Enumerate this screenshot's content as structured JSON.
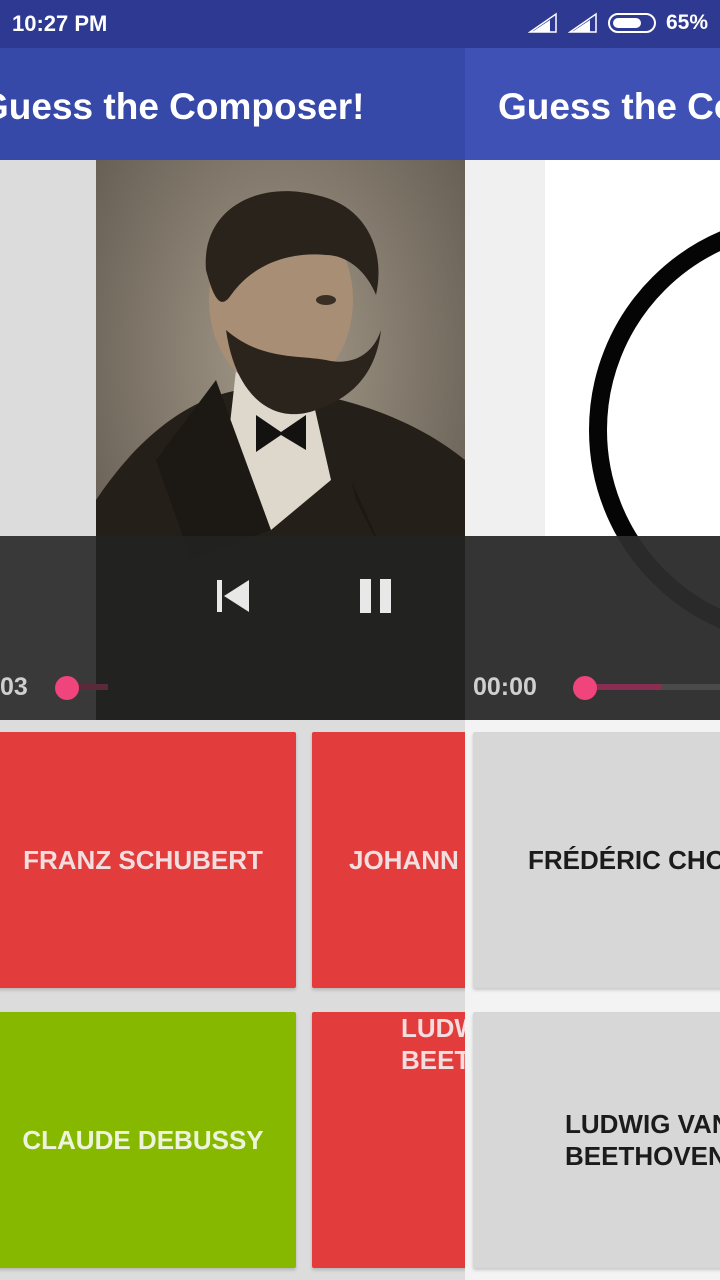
{
  "status": {
    "time": "10:27 PM",
    "battery": "65%"
  },
  "app": {
    "title": "Guess the Composer!",
    "title_partial": "Guess the Co"
  },
  "player_left": {
    "time": "03"
  },
  "player_right": {
    "time": "00:00"
  },
  "answers_left": [
    {
      "label": "FRANZ SCHUBERT",
      "state": "wrong",
      "color": "#e23c3c"
    },
    {
      "label": "JOHANN",
      "state": "wrong",
      "color": "#e23c3c"
    },
    {
      "label": "CLAUDE DEBUSSY",
      "state": "correct",
      "color": "#86b800"
    },
    {
      "label_line1": "LUDW",
      "label_line2": "BEET",
      "state": "wrong",
      "color": "#e23c3c"
    }
  ],
  "answers_right": [
    {
      "label": "FRÉDÉRIC CHOP"
    },
    {
      "label_line1": "LUDWIG VAN",
      "label_line2": "BEETHOVEN"
    }
  ],
  "colors": {
    "appbar": "#3f51b5",
    "statusbar": "#2e3a91",
    "accent": "#f0447c",
    "wrong": "#e23c3c",
    "correct": "#86b800",
    "neutral": "#d6d7d6"
  }
}
